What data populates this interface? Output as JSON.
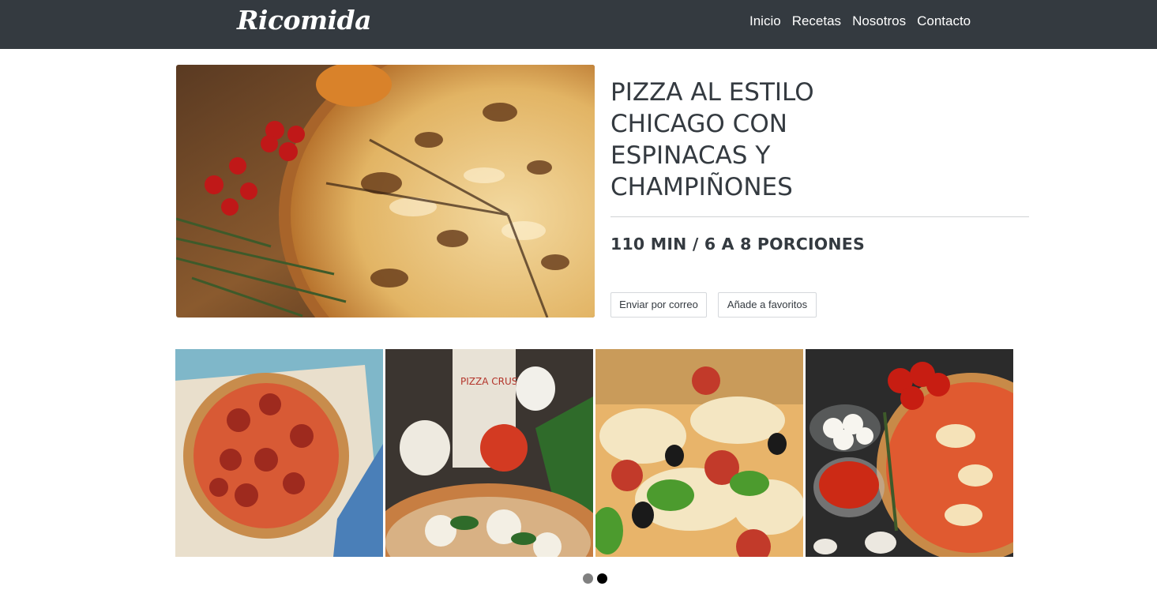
{
  "navbar": {
    "brand": "Ricomida",
    "links": [
      "Inicio",
      "Recetas",
      "Nosotros",
      "Contacto"
    ]
  },
  "recipe": {
    "title": "PIZZA AL ESTILO CHICAGO CON ESPINACAS Y CHAMPIÑONES",
    "meta": "110 MIN / 6 A 8 PORCIONES",
    "buttons": {
      "email": "Enviar por correo",
      "favorite": "Añade a favoritos"
    },
    "hero_image": "chicago-pizza-photo"
  },
  "gallery": {
    "images": [
      "pepperoni-pizza-photo",
      "margherita-pizza-photo",
      "supreme-pizza-photo",
      "tomato-mozzarella-pizza-photo"
    ]
  },
  "carousel": {
    "total": 2,
    "active": 2,
    "colors": {
      "inactive": "#808080",
      "active": "#000000"
    }
  },
  "colors": {
    "navbar_bg": "#343a40",
    "text": "#343a40"
  }
}
